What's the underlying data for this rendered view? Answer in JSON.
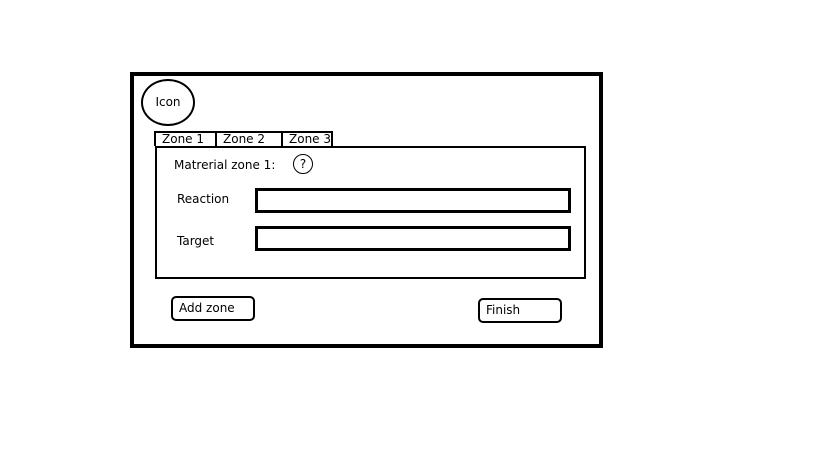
{
  "window": {
    "icon_label": "Icon",
    "tabs": [
      {
        "label": "Zone 1"
      },
      {
        "label": "Zone 2"
      },
      {
        "label": "Zone 3"
      }
    ],
    "panel": {
      "title": "Matrerial zone 1:",
      "help_symbol": "?",
      "fields": {
        "reaction": {
          "label": "Reaction",
          "value": ""
        },
        "target": {
          "label": "Target",
          "value": ""
        }
      }
    },
    "buttons": {
      "add_zone": "Add zone",
      "finish": "Finish"
    }
  }
}
